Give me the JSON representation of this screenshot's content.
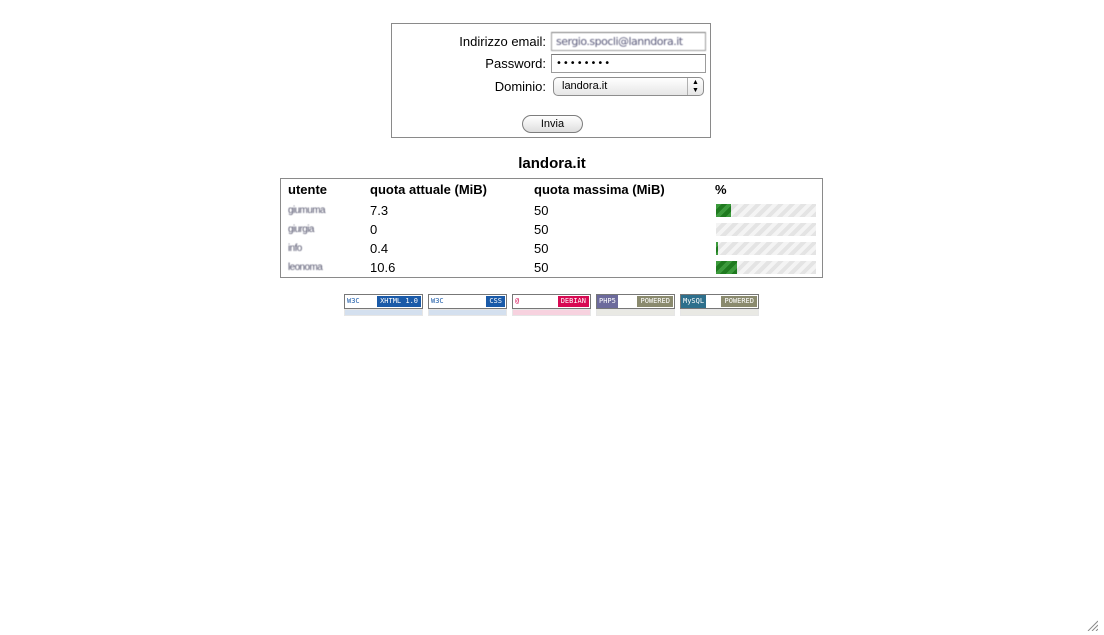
{
  "login": {
    "email_label": "Indirizzo email:",
    "email_value": "sergio.spocli@lanndora.it",
    "password_label": "Password:",
    "password_value": "••••••••",
    "domain_label": "Dominio:",
    "domain_selected": "landora.it",
    "submit_label": "Invia"
  },
  "domain_title": "landora.it",
  "table": {
    "headers": [
      "utente",
      "quota attuale (MiB)",
      "quota massima (MiB)",
      "%"
    ],
    "rows": [
      {
        "user": "giumuma",
        "current": "7.3",
        "max": "50",
        "percent": 14.6
      },
      {
        "user": "giurgia",
        "current": "0",
        "max": "50",
        "percent": 0
      },
      {
        "user": "info",
        "current": "0.4",
        "max": "50",
        "percent": 0.8
      },
      {
        "user": "leonoma",
        "current": "10.6",
        "max": "50",
        "percent": 21.2
      }
    ]
  },
  "badges": [
    {
      "left": "W3C",
      "right": "XHTML 1.0",
      "color": "#1a5aa8"
    },
    {
      "left": "W3C",
      "right": "CSS",
      "color": "#1a5aa8"
    },
    {
      "left": "@",
      "right": "DEBIAN",
      "color": "#d70a53"
    },
    {
      "left": "PHP5",
      "right": "POWERED",
      "color": "#8a8a6e"
    },
    {
      "left": "MySQL",
      "right": "POWERED",
      "color": "#8a8a6e"
    }
  ]
}
